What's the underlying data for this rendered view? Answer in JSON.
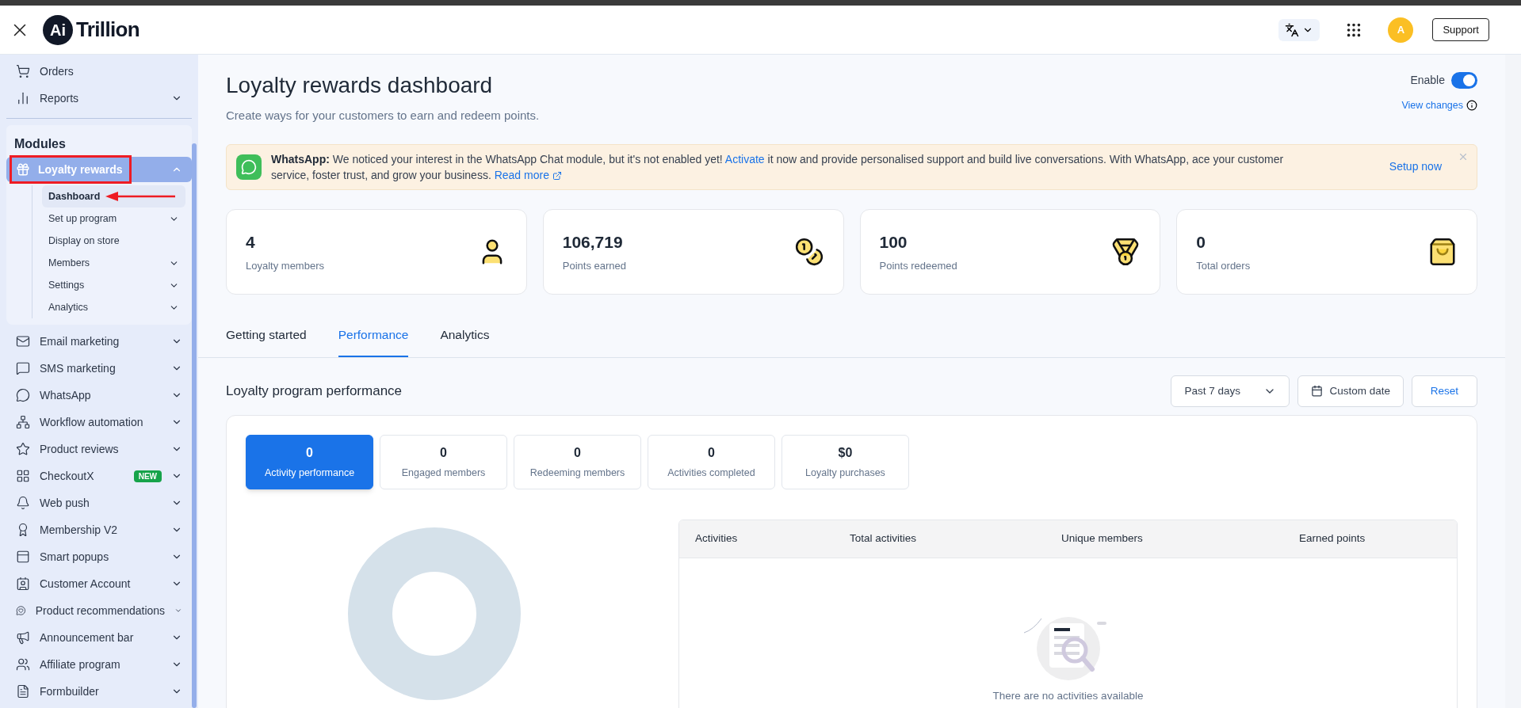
{
  "header": {
    "logo_mark": "Ai",
    "logo_text": "Trillion",
    "avatar": "A",
    "support": "Support"
  },
  "sidebar": {
    "top_items": [
      {
        "label": "Orders",
        "expandable": false
      },
      {
        "label": "Reports",
        "expandable": true
      }
    ],
    "section": "Modules",
    "active_module": {
      "label": "Loyalty rewards",
      "expanded": true,
      "highlighted": true,
      "children": [
        {
          "label": "Dashboard",
          "selected": true,
          "expandable": false
        },
        {
          "label": "Set up program",
          "selected": false,
          "expandable": true
        },
        {
          "label": "Display on store",
          "selected": false,
          "expandable": false
        },
        {
          "label": "Members",
          "selected": false,
          "expandable": true
        },
        {
          "label": "Settings",
          "selected": false,
          "expandable": true
        },
        {
          "label": "Analytics",
          "selected": false,
          "expandable": true
        }
      ]
    },
    "items": [
      {
        "label": "Email marketing"
      },
      {
        "label": "SMS marketing"
      },
      {
        "label": "WhatsApp"
      },
      {
        "label": "Workflow automation"
      },
      {
        "label": "Product reviews"
      },
      {
        "label": "CheckoutX",
        "badge": "NEW"
      },
      {
        "label": "Web push"
      },
      {
        "label": "Membership V2"
      },
      {
        "label": "Smart popups"
      },
      {
        "label": "Customer Account"
      },
      {
        "label": "Product recommendations"
      },
      {
        "label": "Announcement bar"
      },
      {
        "label": "Affiliate program"
      },
      {
        "label": "Formbuilder"
      }
    ]
  },
  "page": {
    "title": "Loyalty rewards dashboard",
    "subtitle": "Create ways for your customers to earn and redeem points.",
    "enable_label": "Enable",
    "enabled": true,
    "view_changes": "View changes"
  },
  "banner": {
    "lead": "WhatsApp:",
    "text_1": "We noticed your interest in the WhatsApp Chat module, but it's not enabled yet!",
    "link": "Activate",
    "text_2": "it now and provide personalised support and build live conversations. With WhatsApp, ace your customer service, foster trust, and grow your business.",
    "read_more": "Read more",
    "action": "Setup now"
  },
  "stats": [
    {
      "value": "4",
      "label": "Loyalty members"
    },
    {
      "value": "106,719",
      "label": "Points earned"
    },
    {
      "value": "100",
      "label": "Points redeemed"
    },
    {
      "value": "0",
      "label": "Total orders"
    }
  ],
  "tabs": [
    {
      "label": "Getting started",
      "selected": false
    },
    {
      "label": "Performance",
      "selected": true
    },
    {
      "label": "Analytics",
      "selected": false
    }
  ],
  "performance": {
    "title": "Loyalty program performance",
    "period": "Past 7 days",
    "custom_date": "Custom date",
    "reset": "Reset",
    "metrics": [
      {
        "value": "0",
        "label": "Activity performance",
        "selected": true
      },
      {
        "value": "0",
        "label": "Engaged members",
        "selected": false
      },
      {
        "value": "0",
        "label": "Redeeming members",
        "selected": false
      },
      {
        "value": "0",
        "label": "Activities completed",
        "selected": false
      },
      {
        "value": "$0",
        "label": "Loyalty purchases",
        "selected": false
      }
    ],
    "table": {
      "columns": [
        "Activities",
        "Total activities",
        "Unique members",
        "Earned points"
      ],
      "empty_text": "There are no activities available"
    }
  }
}
